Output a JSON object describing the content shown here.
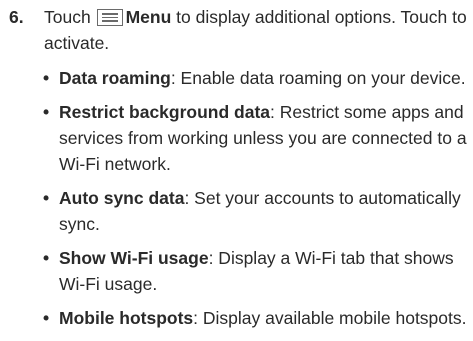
{
  "step": {
    "number": "6.",
    "text_before": "Touch ",
    "icon": "menu-icon",
    "menu_label": "Menu",
    "text_after": " to display additional options. Touch to activate."
  },
  "options": [
    {
      "title": "Data roaming",
      "description": ": Enable data roaming on your device."
    },
    {
      "title": "Restrict background data",
      "description": ": Restrict some apps and services from working unless you are connected to a Wi-Fi network."
    },
    {
      "title": "Auto sync data",
      "description": ": Set your accounts to automatically sync."
    },
    {
      "title": "Show Wi-Fi usage",
      "description": ": Display a Wi-Fi tab that shows Wi-Fi usage."
    },
    {
      "title": "Mobile hotspots",
      "description": ": Display available mobile hotspots."
    }
  ]
}
